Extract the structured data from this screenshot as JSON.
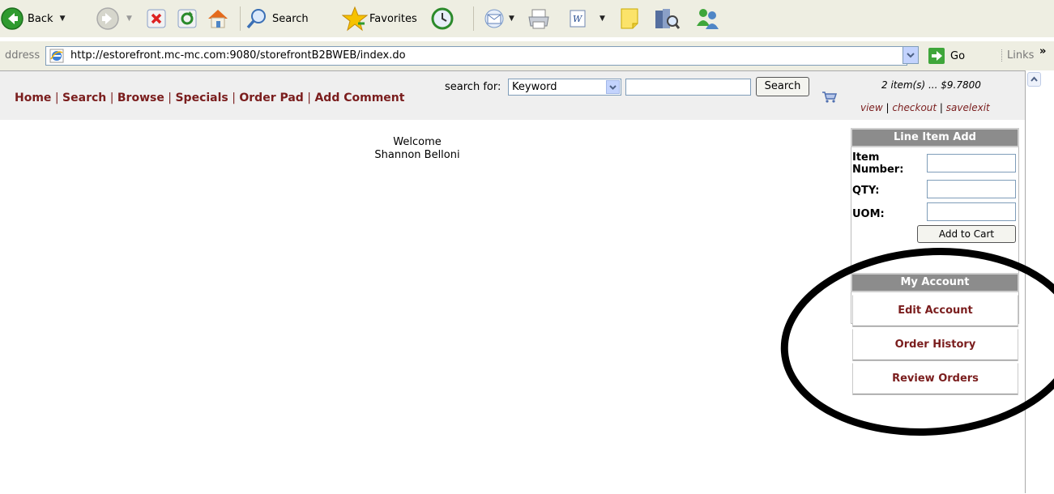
{
  "toolbar": {
    "back_label": "Back",
    "search_label": "Search",
    "favorites_label": "Favorites"
  },
  "address": {
    "label": "ddress",
    "url": "http://estorefront.mc-mc.com:9080/storefrontB2BWEB/index.do",
    "go_label": "Go",
    "links_label": "Links",
    "chevron": "»"
  },
  "nav": {
    "items": [
      "Home",
      "Search",
      "Browse",
      "Specials",
      "Order Pad",
      "Add Comment"
    ],
    "separator": " | "
  },
  "search": {
    "label": "search for:",
    "selected_option": "Keyword",
    "input_value": "",
    "button_label": "Search"
  },
  "cart": {
    "summary": "2 item(s) ... $9.7800",
    "links": [
      "view",
      "checkout",
      "savelexit"
    ]
  },
  "welcome": {
    "line1": "Welcome",
    "line2": "Shannon Belloni"
  },
  "line_item_add": {
    "title": "Line Item Add",
    "item_number_label_1": "Item",
    "item_number_label_2": "Number:",
    "qty_label": "QTY:",
    "uom_label": "UOM:",
    "button_label": "Add to Cart"
  },
  "my_account": {
    "title": "My Account",
    "items": [
      "Edit Account",
      "Order History",
      "Review Orders"
    ]
  },
  "colors": {
    "link": "#7a1d1d",
    "panel_header": "#8c8c8c",
    "toolbar_bg": "#eeeee2",
    "annotation": "#000000"
  }
}
